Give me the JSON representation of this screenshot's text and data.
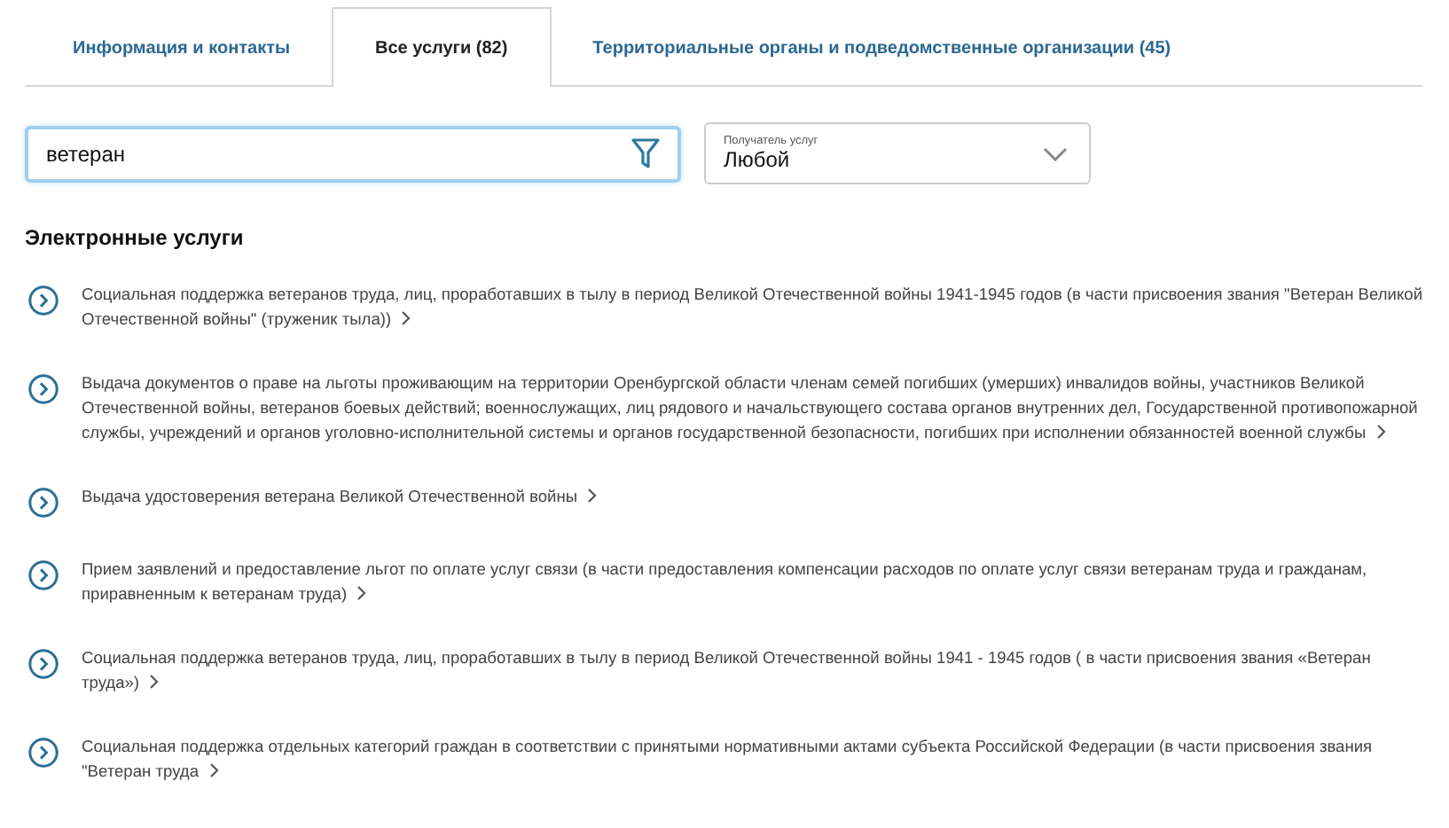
{
  "tabs": [
    {
      "label": "Информация и контакты",
      "selected": false
    },
    {
      "label": "Все услуги (82)",
      "selected": true
    },
    {
      "label": "Территориальные органы и подведомственные организации (45)",
      "selected": false
    }
  ],
  "search": {
    "value": "ветеран"
  },
  "recipient_select": {
    "label": "Получатель услуг",
    "value": "Любой"
  },
  "section_title": "Электронные услуги",
  "services": [
    {
      "text": "Социальная поддержка ветеранов труда, лиц, проработавших в тылу в период Великой Отечественной войны 1941-1945 годов (в части присвоения звания \"Ветеран Великой Отечественной войны\" (труженик тыла))"
    },
    {
      "text": "Выдача документов о праве на льготы проживающим на территории Оренбургской области членам семей погибших (умерших) инвалидов войны, участников Великой Отечественной войны, ветеранов боевых действий; военнослужащих, лиц рядового и начальствующего состава органов внутренних дел, Государственной противопожарной службы, учреждений и органов уголовно-исполнительной системы и органов государственной безопасности, погибших при исполнении обязанностей военной службы"
    },
    {
      "text": "Выдача удостоверения ветерана Великой Отечественной войны"
    },
    {
      "text": "Прием заявлений и предоставление льгот по оплате услуг связи (в части предоставления компенсации расходов по оплате услуг связи ветеранам труда и гражданам, приравненным к ветеранам труда)"
    },
    {
      "text": "Социальная поддержка ветеранов труда, лиц, проработавших в тылу в период Великой Отечественной войны 1941 - 1945 годов ( в части присвоения звания «Ветеран труда»)"
    },
    {
      "text": "Социальная поддержка отдельных категорий граждан в соответствии с принятыми нормативными актами субъекта Российской Федерации (в части присвоения звания \"Ветеран труда"
    }
  ]
}
